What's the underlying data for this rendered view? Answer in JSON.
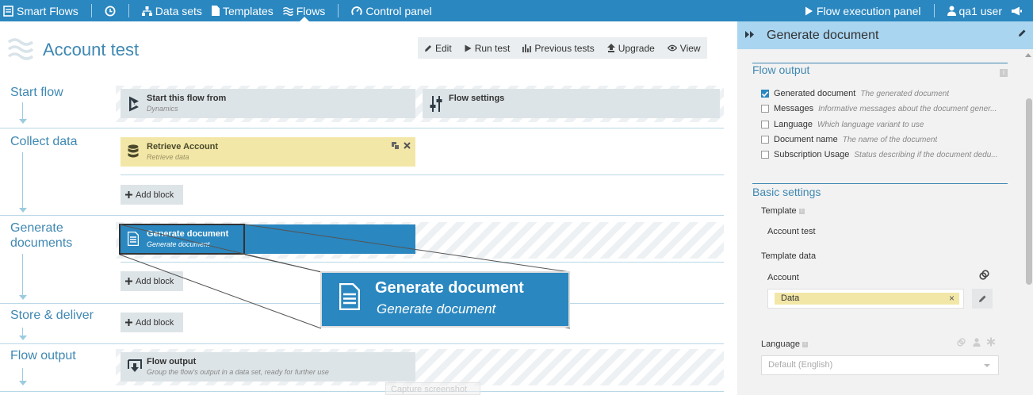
{
  "nav": {
    "brand": "Smart Flows",
    "items": [
      {
        "label": "Data sets",
        "icon": "sitemap-icon"
      },
      {
        "label": "Templates",
        "icon": "document-icon"
      },
      {
        "label": "Flows",
        "icon": "flows-icon"
      },
      {
        "label": "Control panel",
        "icon": "gauge-icon"
      }
    ],
    "execution_panel": "Flow execution panel",
    "user": "qa1 user"
  },
  "page": {
    "title": "Account test",
    "toolbar": [
      "Edit",
      "Run test",
      "Previous tests",
      "Upgrade",
      "View"
    ]
  },
  "stages": {
    "start": {
      "label": "Start flow",
      "blocks": [
        {
          "title": "Start this flow from",
          "subtitle": "Dynamics"
        },
        {
          "title": "Flow settings",
          "subtitle": ""
        }
      ]
    },
    "collect": {
      "label": "Collect data",
      "block": {
        "title": "Retrieve Account",
        "subtitle": "Retrieve data"
      },
      "add_label": "Add block"
    },
    "generate": {
      "label_line1": "Generate",
      "label_line2": "documents",
      "block": {
        "title": "Generate document",
        "subtitle": "Generate document"
      },
      "add_label": "Add block"
    },
    "store": {
      "label": "Store & deliver",
      "add_label": "Add block"
    },
    "output": {
      "label": "Flow output",
      "block": {
        "title": "Flow output",
        "subtitle": "Group the flow's output in a data set, ready for further use"
      }
    }
  },
  "zoom": {
    "title": "Generate document",
    "subtitle": "Generate document"
  },
  "capture_label": "Capture screenshot",
  "panel": {
    "title": "Generate document",
    "flow_output_title": "Flow output",
    "outputs": [
      {
        "name": "Generated document",
        "desc": "The generated document",
        "checked": true
      },
      {
        "name": "Messages",
        "desc": "Informative messages about the document gener...",
        "checked": false
      },
      {
        "name": "Language",
        "desc": "Which language variant to use",
        "checked": false
      },
      {
        "name": "Document name",
        "desc": "The name of the document",
        "checked": false
      },
      {
        "name": "Subscription Usage",
        "desc": "Status describing if the document dedu...",
        "checked": false
      }
    ],
    "basic_settings_title": "Basic settings",
    "template_label": "Template",
    "template_value": "Account test",
    "template_data_label": "Template data",
    "account_label": "Account",
    "data_chip": "Data",
    "language_label": "Language",
    "language_value": "Default (English)"
  },
  "colors": {
    "accent": "#2a87c0",
    "panel_header": "#a9d5f0",
    "block_yellow": "#f3e7a8",
    "stage_text": "#3f88b2"
  }
}
